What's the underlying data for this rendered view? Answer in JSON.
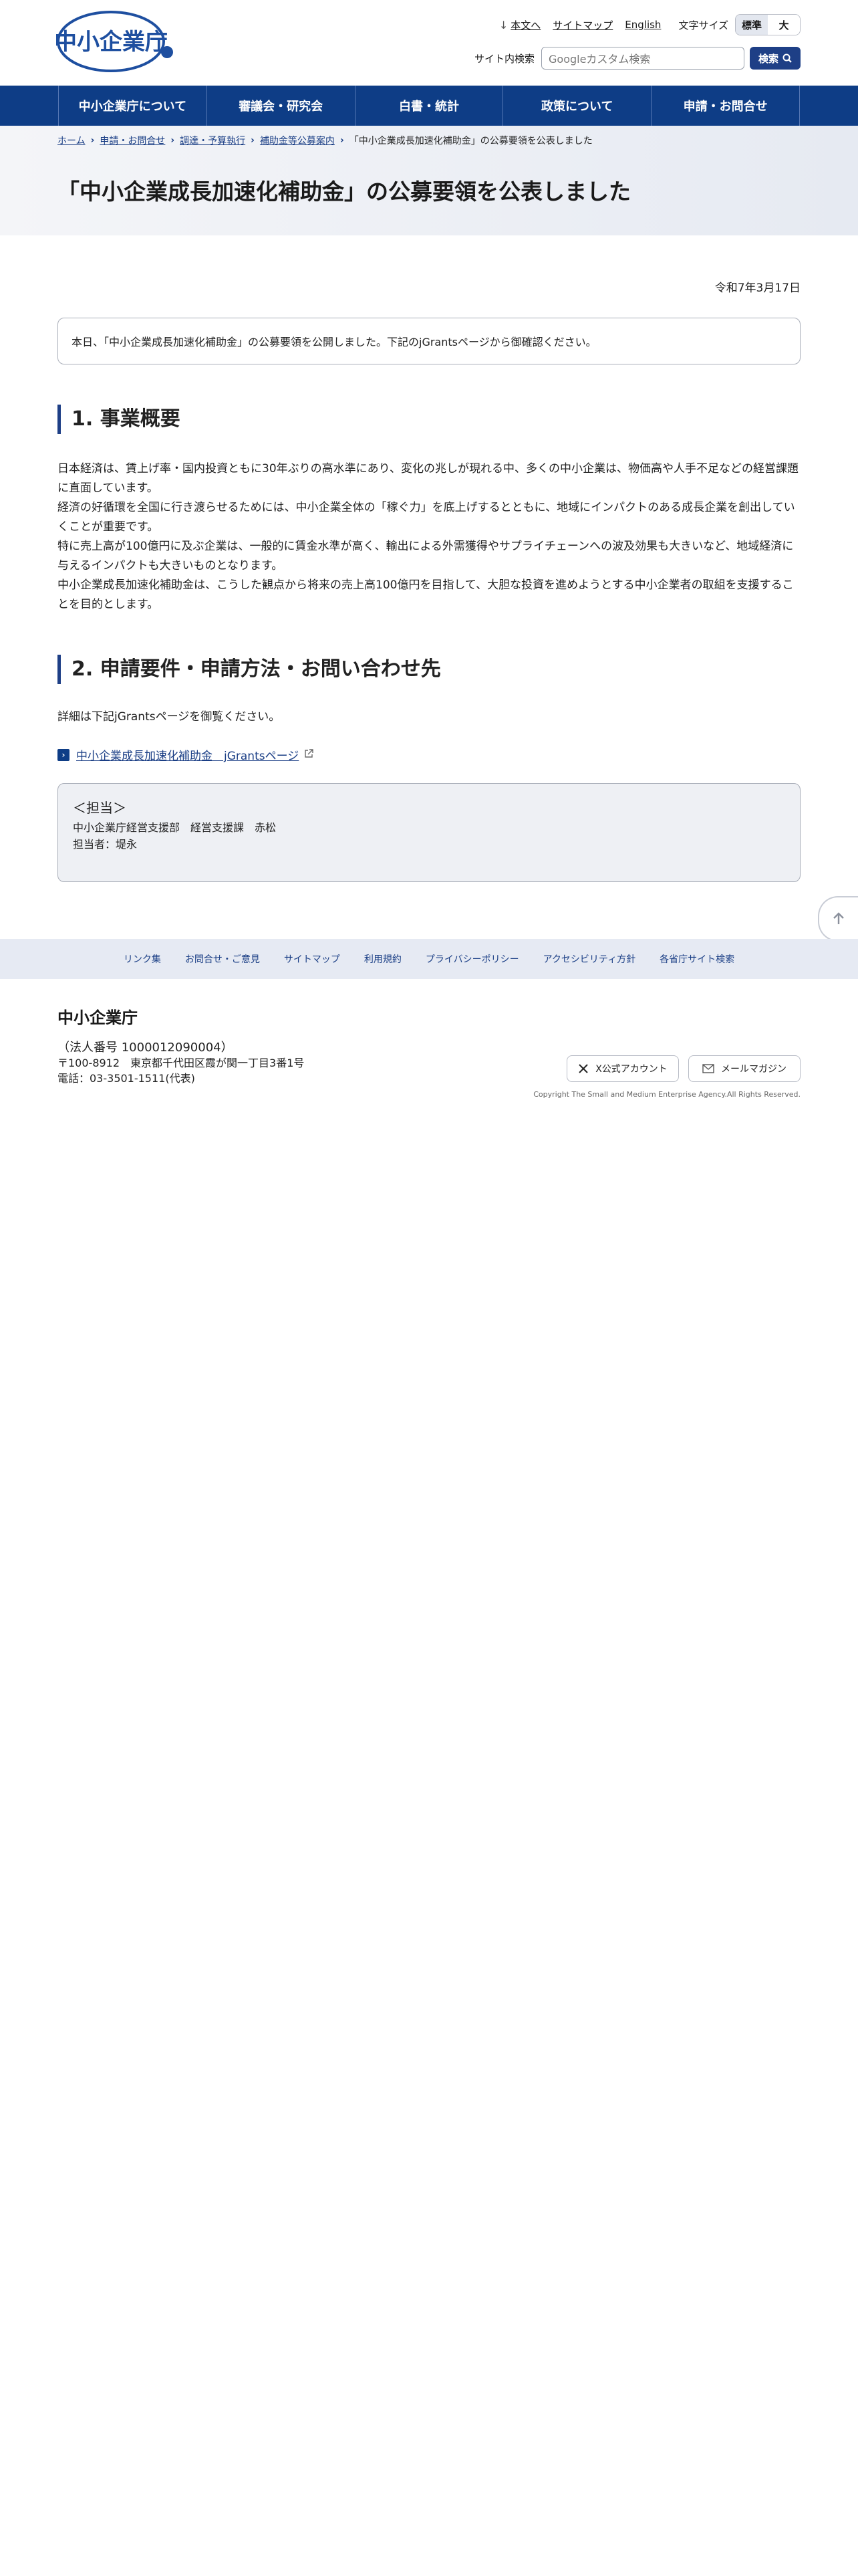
{
  "header": {
    "logo_text": "中小企業庁",
    "skip_link": "本文へ",
    "sitemap": "サイトマップ",
    "english": "English",
    "font_size_label": "文字サイズ",
    "font_standard": "標準",
    "font_large": "大",
    "search_label": "サイト内検索",
    "search_placeholder": "Googleカスタム検索",
    "search_button": "検索"
  },
  "nav": {
    "items": [
      {
        "label": "中小企業庁について"
      },
      {
        "label": "審議会・研究会"
      },
      {
        "label": "白書・統計"
      },
      {
        "label": "政策について"
      },
      {
        "label": "申請・お問合せ"
      }
    ]
  },
  "breadcrumb": {
    "items": [
      "ホーム",
      "申請・お問合せ",
      "調達・予算執行",
      "補助金等公募案内"
    ],
    "current": "「中小企業成長加速化補助金」の公募要領を公表しました"
  },
  "page": {
    "title": "「中小企業成長加速化補助金」の公募要領を公表しました",
    "date": "令和7年3月17日",
    "notice": "本日、「中小企業成長加速化補助金」の公募要領を公開しました。下記のjGrantsページから御確認ください。",
    "section1": {
      "heading": "1. 事業概要",
      "paragraphs": [
        "日本経済は、賃上げ率・国内投資ともに30年ぶりの高水準にあり、変化の兆しが現れる中、多くの中小企業は、物価高や人手不足などの経営課題に直面しています。",
        "経済の好循環を全国に行き渡らせるためには、中小企業全体の「稼ぐ力」を底上げするとともに、地域にインパクトのある成長企業を創出していくことが重要です。",
        "特に売上高が100億円に及ぶ企業は、一般的に賃金水準が高く、輸出による外需獲得やサプライチェーンへの波及効果も大きいなど、地域経済に与えるインパクトも大きいものとなります。",
        "中小企業成長加速化補助金は、こうした観点から将来の売上高100億円を目指して、大胆な投資を進めようとする中小企業者の取組を支援することを目的とします。"
      ]
    },
    "section2": {
      "heading": "2. 申請要件・申請方法・お問い合わせ先",
      "detail": "詳細は下記jGrantsページを御覧ください。",
      "link": "中小企業成長加速化補助金　jGrantsページ"
    },
    "contact": {
      "head": "＜担当＞",
      "line1": "中小企業庁経営支援部　経営支援課　赤松",
      "line2": "担当者：堤永"
    }
  },
  "footer": {
    "links": [
      "リンク集",
      "お問合せ・ご意見",
      "サイトマップ",
      "利用規約",
      "プライバシーポリシー",
      "アクセシビリティ方針",
      "各省庁サイト検索"
    ],
    "agency": "中小企業庁",
    "corp_number": "（法人番号 1000012090004）",
    "address": "〒100-8912　東京都千代田区霞が関一丁目3番1号",
    "phone": "電話：03-3501-1511(代表)",
    "x_account": "X公式アカウント",
    "mail_magazine": "メールマガジン",
    "copyright": "Copyright The Small and Medium Enterprise Agency.All Rights Reserved."
  },
  "colors": {
    "brand": "#0e3d86",
    "link": "#1a3e85",
    "footer_bg": "#e6eaf3"
  }
}
